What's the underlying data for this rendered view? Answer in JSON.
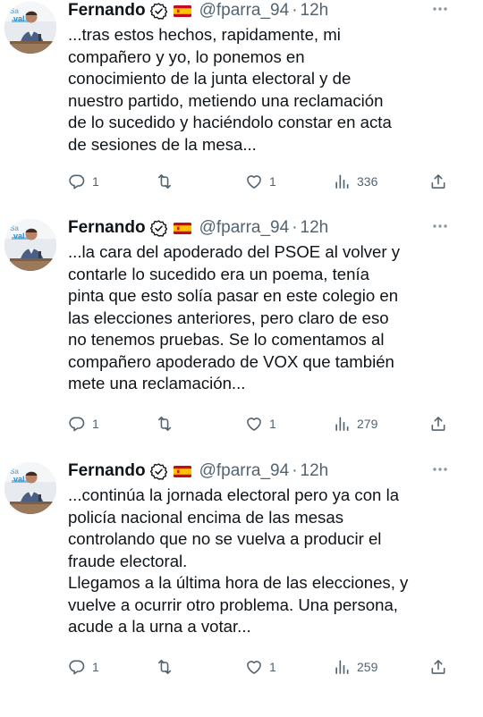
{
  "tweets": [
    {
      "author_name": "Fernando",
      "handle": "@fparra_94",
      "separator": "·",
      "time": "12h",
      "text": "...tras estos hechos, rapidamente, mi\ncompañero y yo, lo ponemos en\nconocimiento de la junta electoral y de\nnuestro partido, metiendo una reclamación\nde lo sucedido y haciéndolo constar en acta\nde sesiones de la mesa...",
      "replies": "1",
      "retweets": "",
      "likes": "1",
      "views": "336"
    },
    {
      "author_name": "Fernando",
      "handle": "@fparra_94",
      "separator": "·",
      "time": "12h",
      "text": "...la cara del apoderado del PSOE al volver y\ncontarle lo sucedido era un poema, tenía\npinta que esto solía pasar en este colegio en\nlas elecciones anteriores, pero claro de eso\nno tenemos pruebas. Se lo comentamos al\ncompañero apoderado de VOX que también\nmete una reclamación...",
      "replies": "1",
      "retweets": "",
      "likes": "1",
      "views": "279"
    },
    {
      "author_name": "Fernando",
      "handle": "@fparra_94",
      "separator": "·",
      "time": "12h",
      "text": "...continúa la jornada electoral pero ya con la\npolicía nacional encima de las mesas\ncontrolando que no se vuelva a producir el\nfraude electoral.\nLlegamos a la última hora de las elecciones, y\nvuelve a ocurrir otro problema. Una persona,\nacude a la urna a votar...",
      "replies": "1",
      "retweets": "",
      "likes": "1",
      "views": "259"
    }
  ],
  "icons": {
    "verified": "verified-badge-icon",
    "flag": "spain-flag-icon",
    "more": "more-dots-icon",
    "reply": "reply-bubble-icon",
    "retweet": "retweet-icon",
    "like": "heart-icon",
    "views": "analytics-bars-icon",
    "share": "share-upload-icon"
  },
  "colors": {
    "text": "#0f1419",
    "secondary": "#536471",
    "flag_red": "#c60b1e",
    "flag_yellow": "#ffc400"
  }
}
